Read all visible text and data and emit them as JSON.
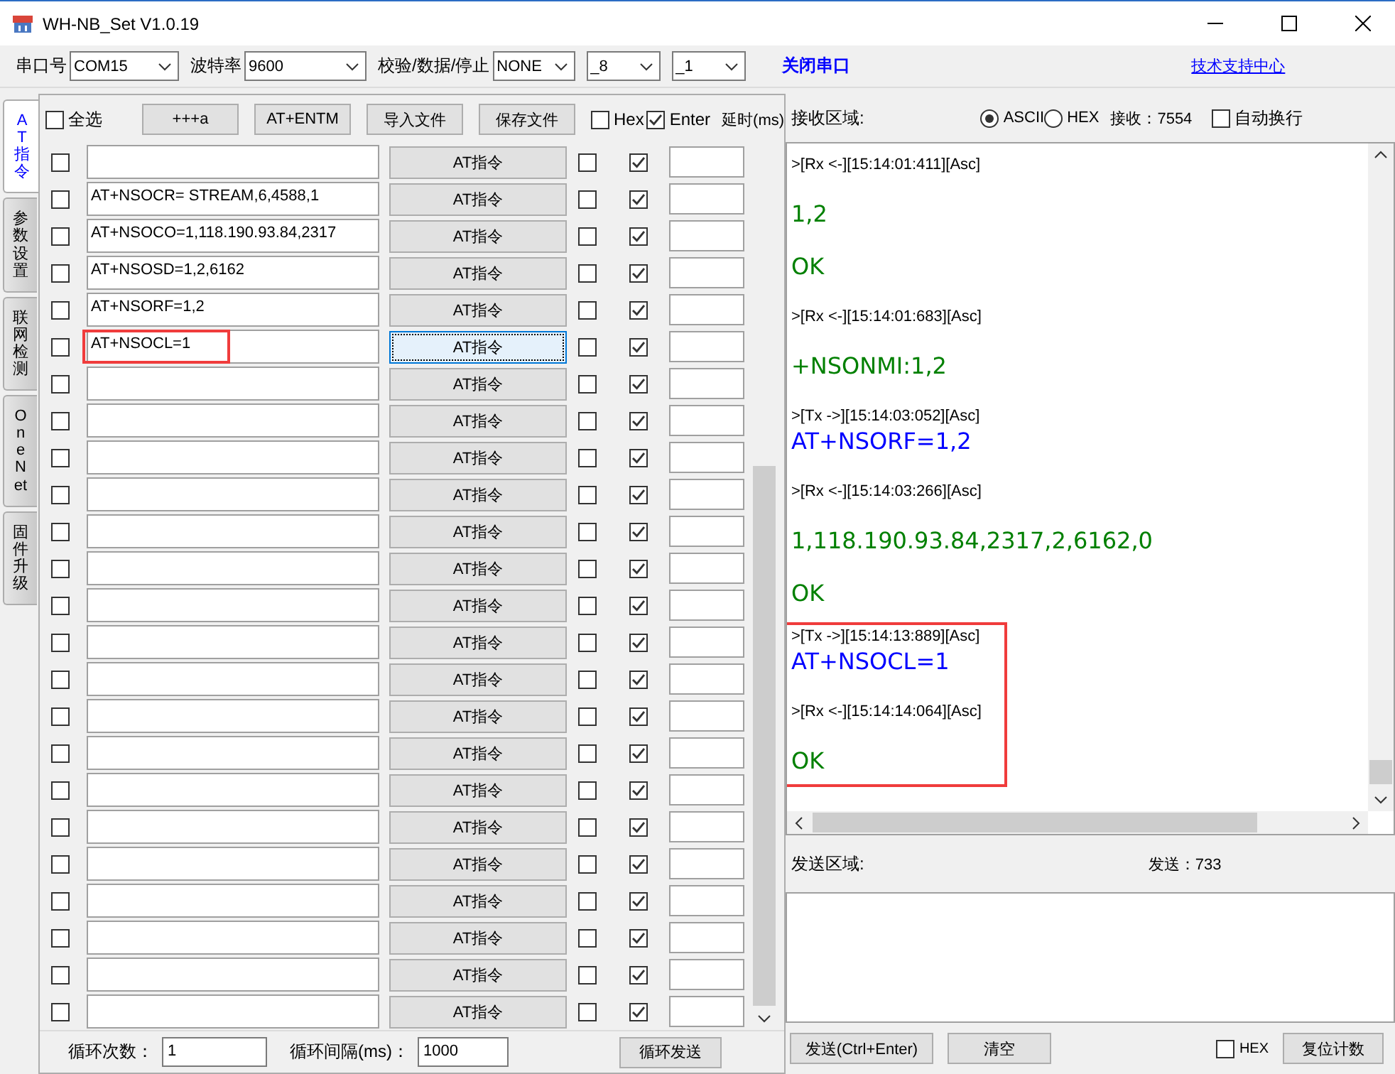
{
  "window": {
    "title": "WH-NB_Set V1.0.19"
  },
  "serial": {
    "port_label": "串口号",
    "port": "COM15",
    "baud_label": "波特率",
    "baud": "9600",
    "format_label": "校验/数据/停止",
    "parity": "NONE",
    "data_bits": "_8",
    "stop_bits": "_1",
    "close_button": "关闭串口",
    "support_link": "技术支持中心"
  },
  "tabs": [
    {
      "label": "AT指令",
      "selected": true
    },
    {
      "label": "参数设置",
      "selected": false
    },
    {
      "label": "联网检测",
      "selected": false
    },
    {
      "label": "OneNet",
      "selected": false
    },
    {
      "label": "固件升级",
      "selected": false
    }
  ],
  "commands_header": {
    "select_all": {
      "label": "全选",
      "checked": false
    },
    "buttons": [
      "+++a",
      "AT+ENTM",
      "导入文件",
      "保存文件"
    ],
    "hex": {
      "label": "Hex",
      "checked": false
    },
    "enter": {
      "label": "Enter",
      "checked": true
    },
    "delay_label": "延时(ms)"
  },
  "rows": [
    {
      "command": "",
      "button": "AT指令",
      "selected": false,
      "hex": false,
      "enter": true,
      "focused": false,
      "highlighted": false
    },
    {
      "command": "AT+NSOCR= STREAM,6,4588,1",
      "button": "AT指令",
      "selected": false,
      "hex": false,
      "enter": true,
      "focused": false,
      "highlighted": false
    },
    {
      "command": "AT+NSOCO=1,118.190.93.84,2317",
      "button": "AT指令",
      "selected": false,
      "hex": false,
      "enter": true,
      "focused": false,
      "highlighted": false
    },
    {
      "command": "AT+NSOSD=1,2,6162",
      "button": "AT指令",
      "selected": false,
      "hex": false,
      "enter": true,
      "focused": false,
      "highlighted": false
    },
    {
      "command": "AT+NSORF=1,2",
      "button": "AT指令",
      "selected": false,
      "hex": false,
      "enter": true,
      "focused": false,
      "highlighted": false
    },
    {
      "command": "AT+NSOCL=1",
      "button": "AT指令",
      "selected": false,
      "hex": false,
      "enter": true,
      "focused": true,
      "highlighted": true
    },
    {
      "command": "",
      "button": "AT指令",
      "selected": false,
      "hex": false,
      "enter": true,
      "focused": false,
      "highlighted": false
    },
    {
      "command": "",
      "button": "AT指令",
      "selected": false,
      "hex": false,
      "enter": true,
      "focused": false,
      "highlighted": false
    },
    {
      "command": "",
      "button": "AT指令",
      "selected": false,
      "hex": false,
      "enter": true,
      "focused": false,
      "highlighted": false
    },
    {
      "command": "",
      "button": "AT指令",
      "selected": false,
      "hex": false,
      "enter": true,
      "focused": false,
      "highlighted": false
    },
    {
      "command": "",
      "button": "AT指令",
      "selected": false,
      "hex": false,
      "enter": true,
      "focused": false,
      "highlighted": false
    },
    {
      "command": "",
      "button": "AT指令",
      "selected": false,
      "hex": false,
      "enter": true,
      "focused": false,
      "highlighted": false
    },
    {
      "command": "",
      "button": "AT指令",
      "selected": false,
      "hex": false,
      "enter": true,
      "focused": false,
      "highlighted": false
    },
    {
      "command": "",
      "button": "AT指令",
      "selected": false,
      "hex": false,
      "enter": true,
      "focused": false,
      "highlighted": false
    },
    {
      "command": "",
      "button": "AT指令",
      "selected": false,
      "hex": false,
      "enter": true,
      "focused": false,
      "highlighted": false
    },
    {
      "command": "",
      "button": "AT指令",
      "selected": false,
      "hex": false,
      "enter": true,
      "focused": false,
      "highlighted": false
    },
    {
      "command": "",
      "button": "AT指令",
      "selected": false,
      "hex": false,
      "enter": true,
      "focused": false,
      "highlighted": false
    },
    {
      "command": "",
      "button": "AT指令",
      "selected": false,
      "hex": false,
      "enter": true,
      "focused": false,
      "highlighted": false
    },
    {
      "command": "",
      "button": "AT指令",
      "selected": false,
      "hex": false,
      "enter": true,
      "focused": false,
      "highlighted": false
    },
    {
      "command": "",
      "button": "AT指令",
      "selected": false,
      "hex": false,
      "enter": true,
      "focused": false,
      "highlighted": false
    },
    {
      "command": "",
      "button": "AT指令",
      "selected": false,
      "hex": false,
      "enter": true,
      "focused": false,
      "highlighted": false
    },
    {
      "command": "",
      "button": "AT指令",
      "selected": false,
      "hex": false,
      "enter": true,
      "focused": false,
      "highlighted": false
    },
    {
      "command": "",
      "button": "AT指令",
      "selected": false,
      "hex": false,
      "enter": true,
      "focused": false,
      "highlighted": false
    },
    {
      "command": "",
      "button": "AT指令",
      "selected": false,
      "hex": false,
      "enter": true,
      "focused": false,
      "highlighted": false
    }
  ],
  "loop": {
    "count_label": "循环次数：",
    "count": "1",
    "interval_label": "循环间隔(ms)：",
    "interval": "1000",
    "send_button": "循环发送"
  },
  "receive": {
    "label": "接收区域:",
    "modes": [
      {
        "label": "ASCII",
        "selected": true
      },
      {
        "label": "HEX",
        "selected": false
      }
    ],
    "count": "接收：7554",
    "wrap": {
      "label": "自动换行",
      "checked": false
    }
  },
  "log": [
    {
      "kind": "header",
      "text": ">[Rx <-][15:14:01:411][Asc]",
      "highlighted": false
    },
    {
      "kind": "rx",
      "text": "1,2",
      "highlighted": false
    },
    {
      "kind": "rx",
      "text": "OK",
      "highlighted": false
    },
    {
      "kind": "header",
      "text": ">[Rx <-][15:14:01:683][Asc]",
      "highlighted": false
    },
    {
      "kind": "rx",
      "text": "+NSONMI:1,2",
      "highlighted": false
    },
    {
      "kind": "header",
      "text": ">[Tx ->][15:14:03:052][Asc]",
      "highlighted": false
    },
    {
      "kind": "tx",
      "text": "AT+NSORF=1,2",
      "highlighted": false
    },
    {
      "kind": "header",
      "text": ">[Rx <-][15:14:03:266][Asc]",
      "highlighted": false
    },
    {
      "kind": "rx",
      "text": "1,118.190.93.84,2317,2,6162,0",
      "highlighted": false
    },
    {
      "kind": "rx",
      "text": "OK",
      "highlighted": false
    },
    {
      "kind": "header",
      "text": ">[Tx ->][15:14:13:889][Asc]",
      "highlighted": true
    },
    {
      "kind": "tx",
      "text": "AT+NSOCL=1",
      "highlighted": true
    },
    {
      "kind": "header",
      "text": ">[Rx <-][15:14:14:064][Asc]",
      "highlighted": true
    },
    {
      "kind": "rx",
      "text": "OK",
      "highlighted": true
    }
  ],
  "send": {
    "label": "发送区域:",
    "count": "发送：733",
    "send_button": "发送(Ctrl+Enter)",
    "clear_button": "清空",
    "hex": {
      "label": "HEX",
      "checked": false
    },
    "reset_button": "复位计数"
  }
}
